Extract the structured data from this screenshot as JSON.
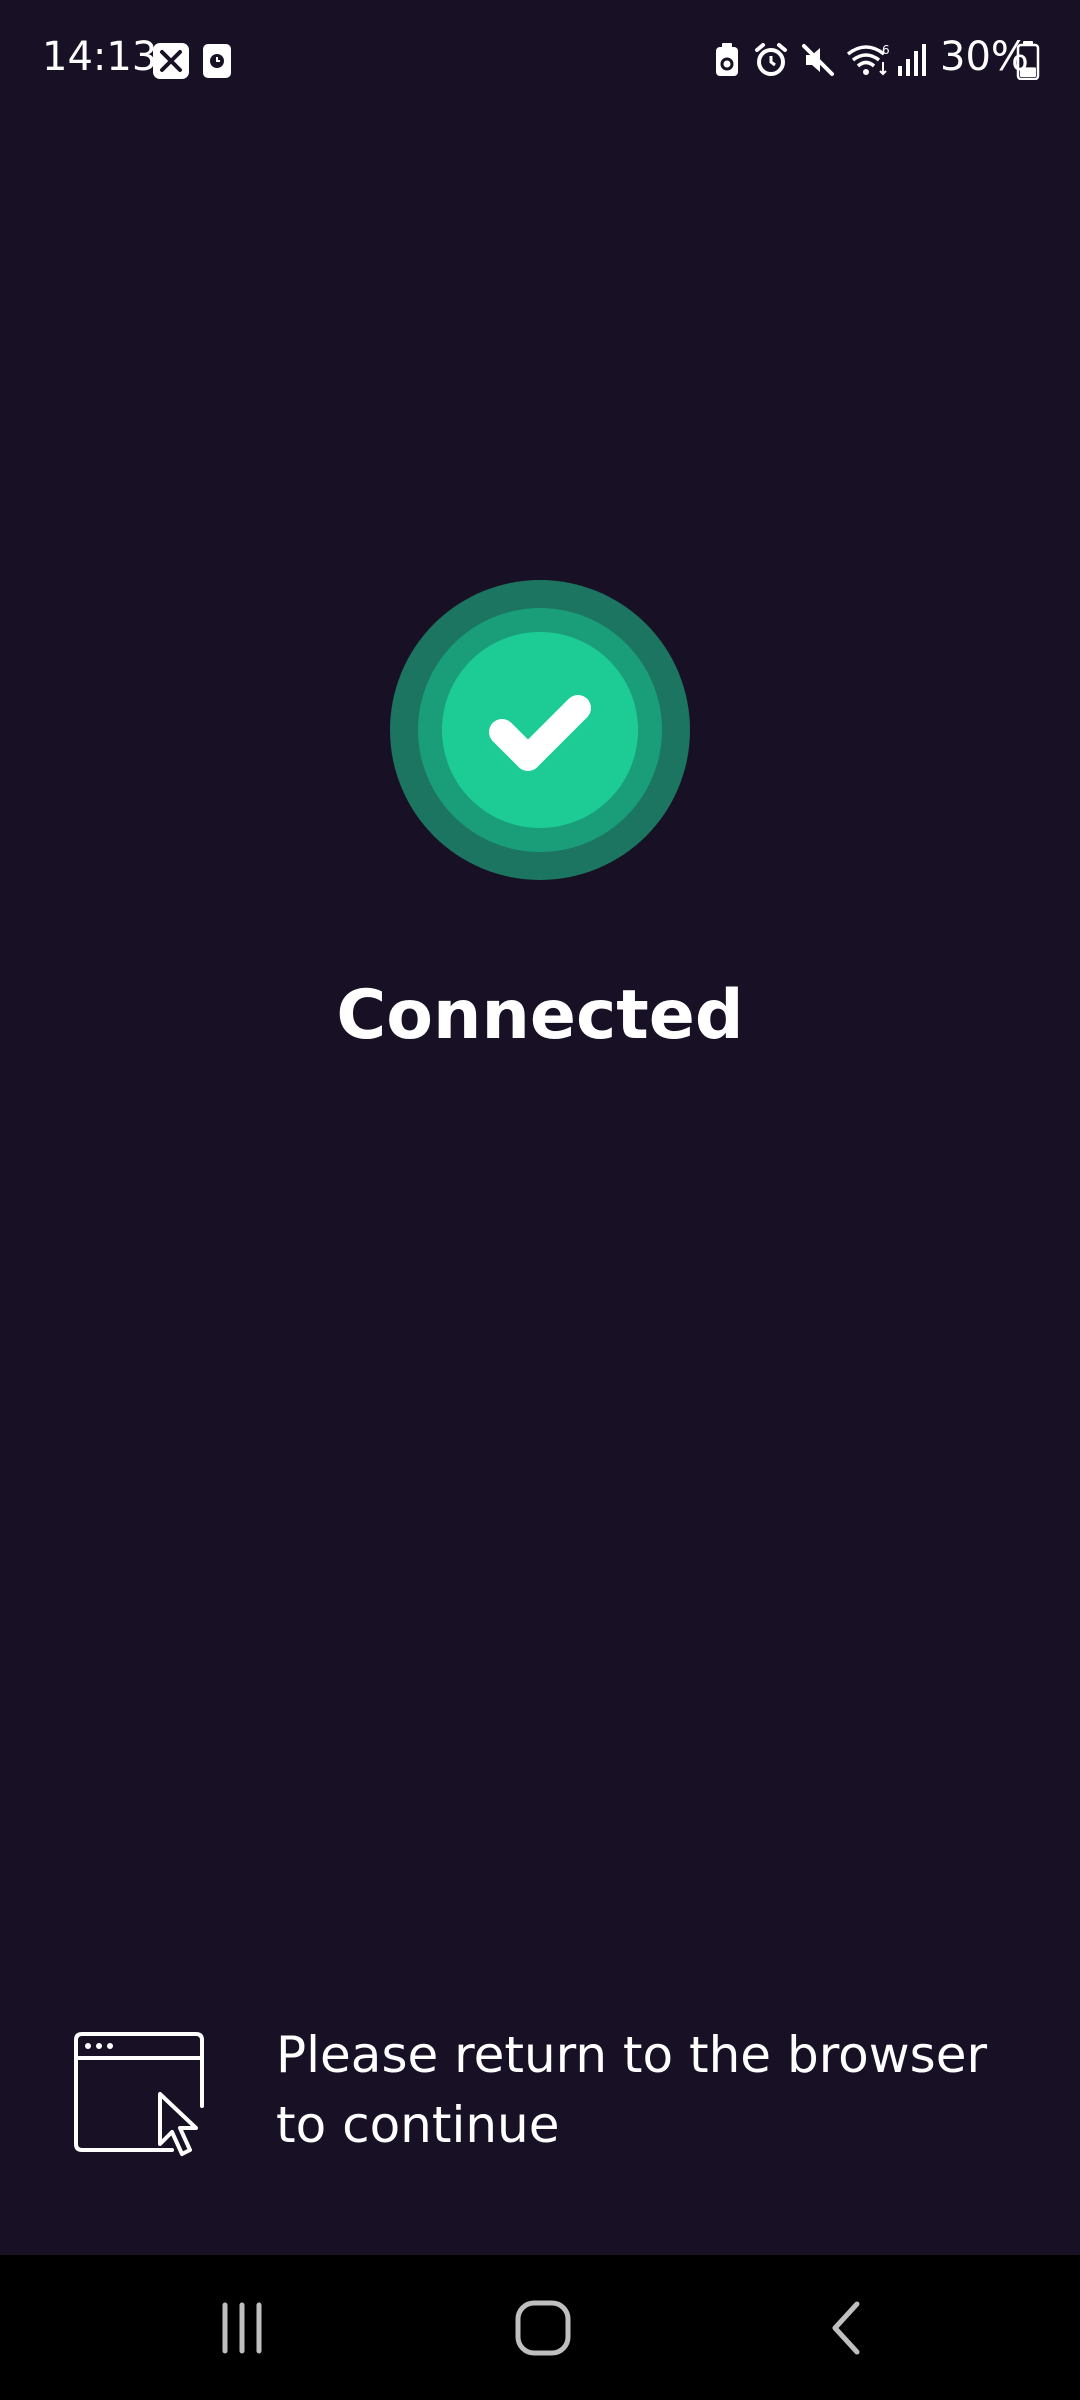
{
  "status_bar": {
    "time": "14:13",
    "battery_percent": "30%",
    "battery_level": 0.3,
    "icons": [
      "x-app-icon",
      "clock-app-icon",
      "battery-saver-icon",
      "alarm-icon",
      "mute-icon",
      "wifi-6-icon",
      "signal-icon",
      "battery-icon"
    ]
  },
  "main": {
    "status_title": "Connected",
    "status_icon": "check-circle-icon",
    "accent_color": "#1dcc95"
  },
  "hint": {
    "icon": "browser-cursor-icon",
    "text": "Please return to the browser to continue"
  },
  "nav_bar": {
    "buttons": [
      "recents-icon",
      "home-icon",
      "back-icon"
    ]
  }
}
